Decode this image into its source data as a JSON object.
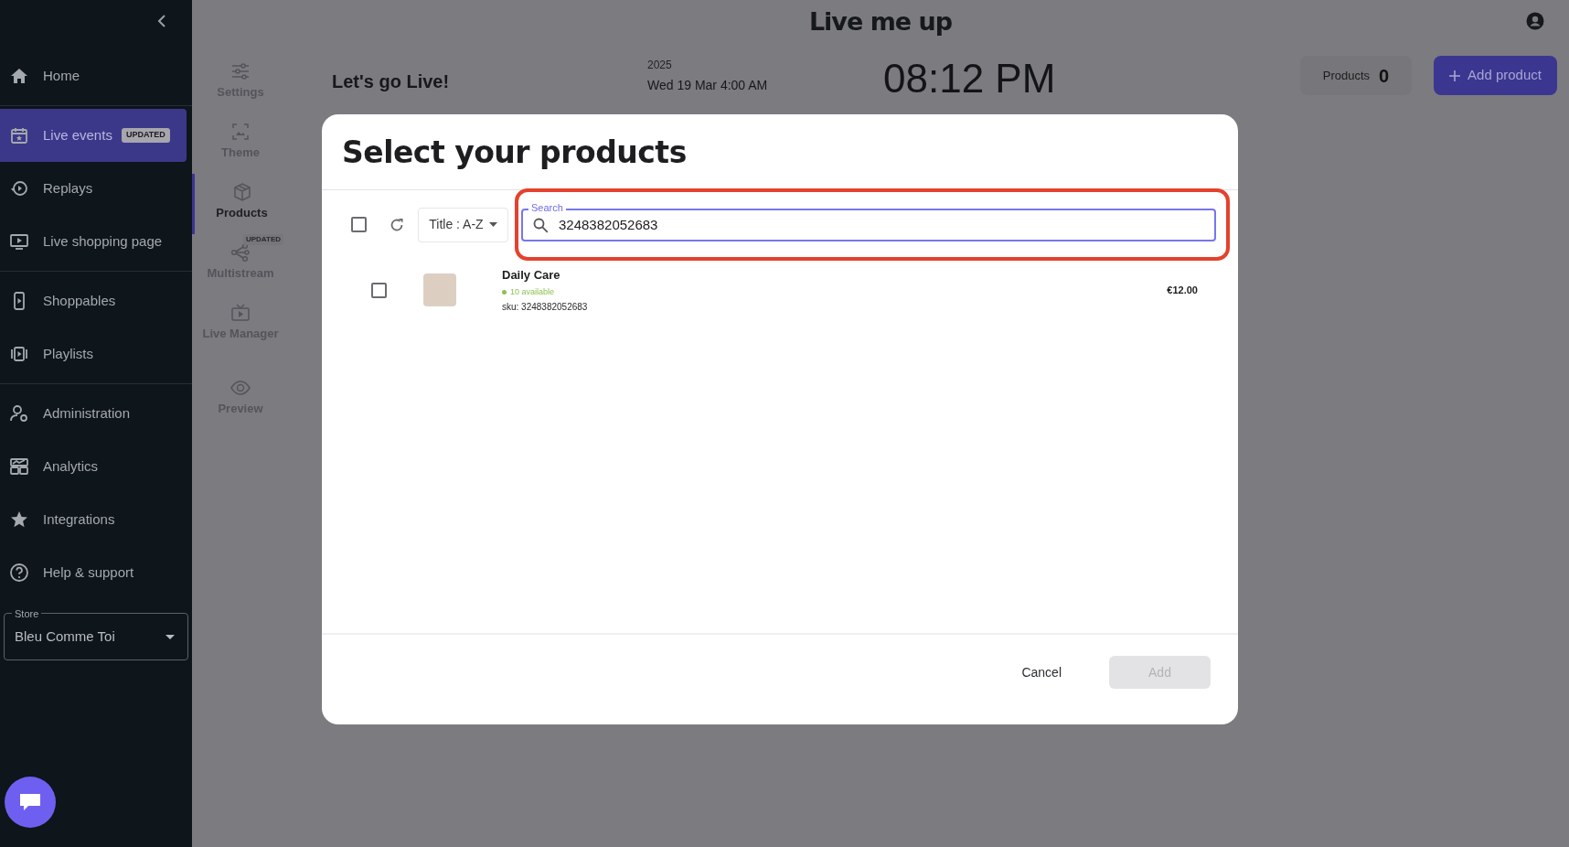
{
  "sidebar": {
    "sections": [
      [
        {
          "label": "Home",
          "selected": false
        }
      ],
      [
        {
          "label": "Live events",
          "selected": true,
          "badge": "UPDATED"
        },
        {
          "label": "Replays",
          "selected": false
        },
        {
          "label": "Live shopping page",
          "selected": false
        }
      ],
      [
        {
          "label": "Shoppables",
          "selected": false
        },
        {
          "label": "Playlists",
          "selected": false
        }
      ],
      [
        {
          "label": "Administration",
          "selected": false
        },
        {
          "label": "Analytics",
          "selected": false
        },
        {
          "label": "Integrations",
          "selected": false
        },
        {
          "label": "Help & support",
          "selected": false
        }
      ]
    ],
    "store": {
      "label": "Store",
      "value": "Bleu Comme Toi"
    }
  },
  "subnav": {
    "items": [
      {
        "label": "Settings",
        "selected": false
      },
      {
        "label": "Theme",
        "selected": false
      },
      {
        "label": "Products",
        "selected": true
      },
      {
        "label": "Multistream",
        "selected": false,
        "badge": "UPDATED"
      },
      {
        "label": "Live Manager",
        "selected": false
      },
      {
        "label": "Preview",
        "selected": false
      }
    ]
  },
  "header": {
    "logo": "Live me up",
    "title": "Let's go Live!",
    "year": "2025",
    "date": "Wed 19 Mar 4:00 AM",
    "time": "08:12 PM",
    "products_label": "Products",
    "products_count": "0",
    "add_button": "Add product"
  },
  "modal": {
    "title": "Select your products",
    "select_all": {
      "checked": false
    },
    "sort": "Title : A-Z",
    "search": {
      "label": "Search",
      "value": "3248382052683"
    },
    "products": [
      {
        "name": "Daily Care",
        "availability": "10 available",
        "in_stock": true,
        "sku": "sku: 3248382052683",
        "price": "€12.00",
        "checked": false
      }
    ],
    "cancel": "Cancel",
    "add": {
      "label": "Add",
      "disabled": true
    }
  }
}
